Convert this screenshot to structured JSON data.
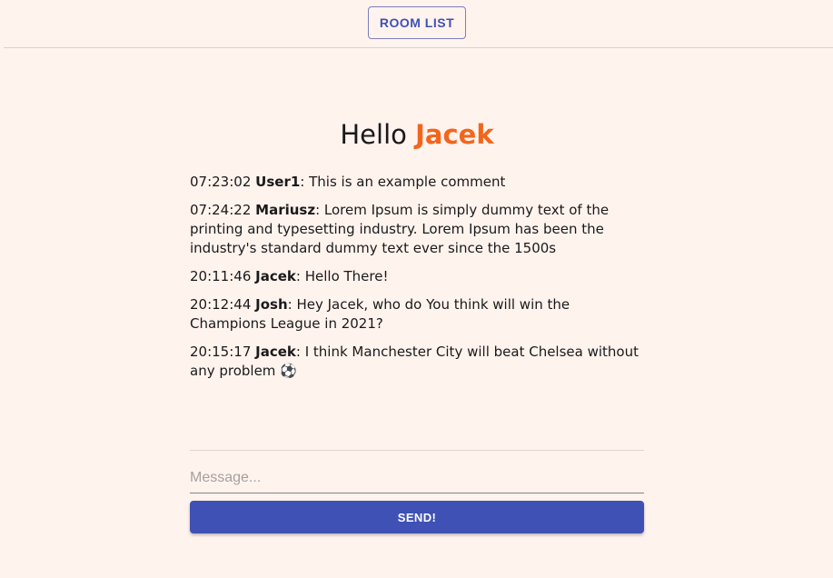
{
  "header": {
    "room_list_label": "ROOM LIST"
  },
  "greeting": {
    "prefix": "Hello",
    "username": "Jacek"
  },
  "messages": [
    {
      "time": "07:23:02",
      "author": "User1",
      "text": ": This is an example comment"
    },
    {
      "time": "07:24:22",
      "author": "Mariusz",
      "text": ": Lorem Ipsum is simply dummy text of the printing and typesetting industry. Lorem Ipsum has been the industry's standard dummy text ever since the 1500s"
    },
    {
      "time": "20:11:46",
      "author": "Jacek",
      "text": ": Hello There!"
    },
    {
      "time": "20:12:44",
      "author": "Josh",
      "text": ": Hey Jacek, who do You think will win the Champions League in 2021?"
    },
    {
      "time": "20:15:17",
      "author": "Jacek",
      "text": ":  I think Manchester City will beat Chelsea without any problem ⚽"
    }
  ],
  "composer": {
    "placeholder": "Message...",
    "value": "",
    "send_label": "SEND!"
  },
  "colors": {
    "background": "#fff3ee",
    "accent": "#3f51b5",
    "username": "#f2661c"
  }
}
